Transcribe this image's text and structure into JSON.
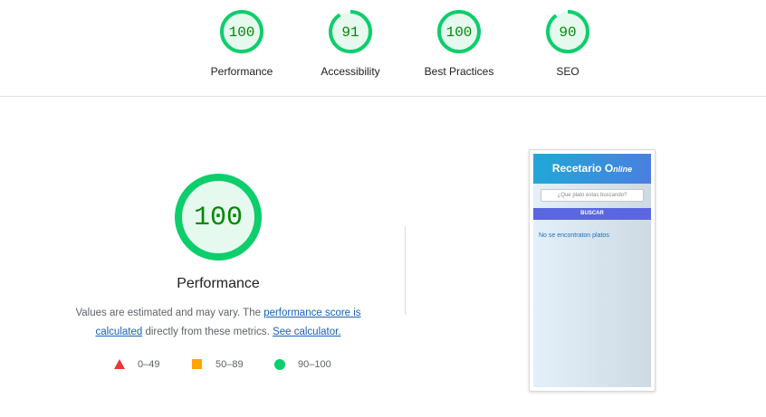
{
  "categories": [
    {
      "label": "Performance",
      "score": "100",
      "fraction": 1.0
    },
    {
      "label": "Accessibility",
      "score": "91",
      "fraction": 0.91
    },
    {
      "label": "Best Practices",
      "score": "100",
      "fraction": 1.0
    },
    {
      "label": "SEO",
      "score": "90",
      "fraction": 0.9
    }
  ],
  "main": {
    "score": "100",
    "fraction": 1.0,
    "title": "Performance",
    "desc_prefix": "Values are estimated and may vary. The ",
    "desc_link": "performance score is calculated",
    "desc_middle": " directly from these metrics. ",
    "calc_link": "See calculator."
  },
  "legend": [
    {
      "range": "0–49",
      "shape": "triangle",
      "color": "#e53935"
    },
    {
      "range": "50–89",
      "shape": "square",
      "color": "#ffa400"
    },
    {
      "range": "90–100",
      "shape": "circle",
      "color": "#0cce6b"
    }
  ],
  "colors": {
    "pass_ring": "#0cce6b",
    "pass_fill": "#e6f9ef",
    "pass_text": "#008800"
  },
  "thumbnail": {
    "brand": "Recetario O",
    "brand_suffix": "nline",
    "search_placeholder": "¿Que plato estas buscando?",
    "button": "BUSCAR",
    "empty_message": "No se encontraton platos"
  }
}
